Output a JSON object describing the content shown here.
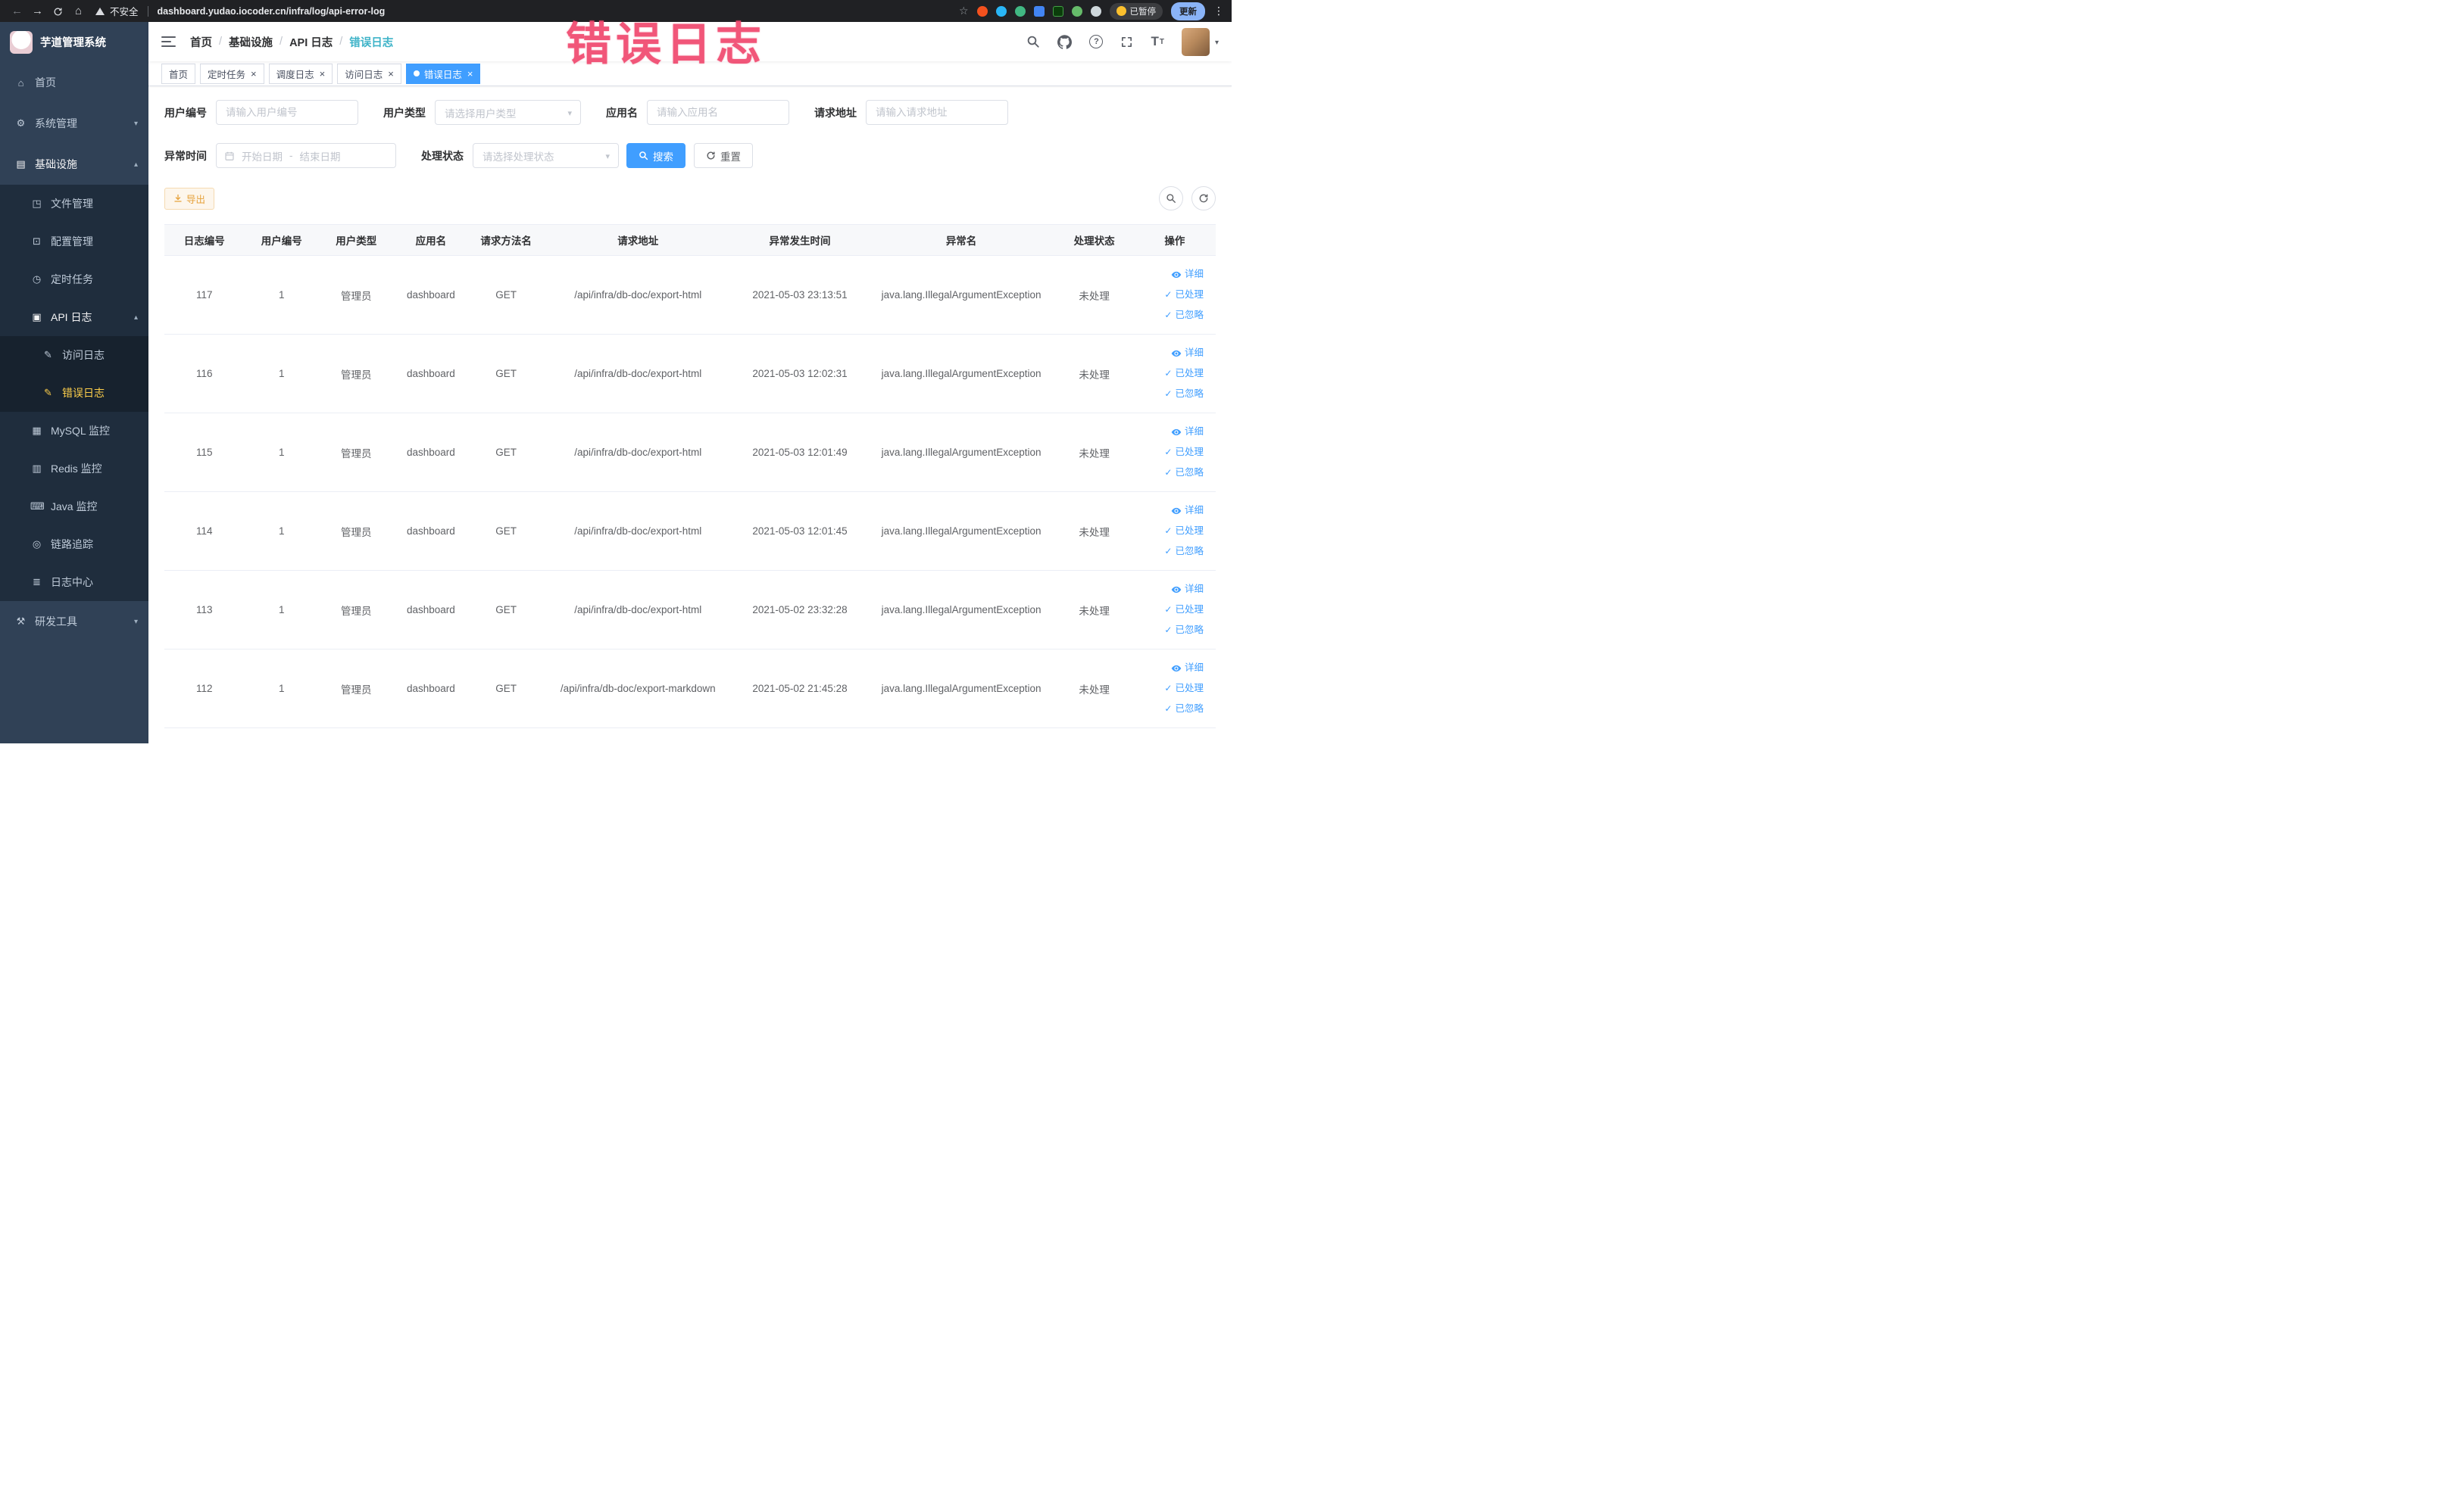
{
  "browser": {
    "insecure_label": "不安全",
    "url": "dashboard.yudao.iocoder.cn/infra/log/api-error-log",
    "paused_badge": "已暂停",
    "update_button": "更新"
  },
  "annotation": {
    "text": "错误日志"
  },
  "sidebar": {
    "logo_title": "芋道管理系统",
    "menu": [
      {
        "label": "首页",
        "icon": "home",
        "type": "top"
      },
      {
        "label": "系统管理",
        "icon": "gear",
        "type": "top",
        "chevron": "down"
      },
      {
        "label": "基础设施",
        "icon": "infra",
        "type": "top",
        "chevron": "up",
        "open": true
      },
      {
        "label": "文件管理",
        "icon": "file",
        "type": "sub1"
      },
      {
        "label": "配置管理",
        "icon": "config",
        "type": "sub1"
      },
      {
        "label": "定时任务",
        "icon": "timer",
        "type": "sub1"
      },
      {
        "label": "API 日志",
        "icon": "api",
        "type": "sub1",
        "chevron": "up",
        "open": true
      },
      {
        "label": "访问日志",
        "icon": "doc",
        "type": "sub2"
      },
      {
        "label": "错误日志",
        "icon": "doc",
        "type": "sub2",
        "active": true
      },
      {
        "label": "MySQL 监控",
        "icon": "mysql",
        "type": "sub1"
      },
      {
        "label": "Redis 监控",
        "icon": "redis",
        "type": "sub1"
      },
      {
        "label": "Java 监控",
        "icon": "java",
        "type": "sub1"
      },
      {
        "label": "链路追踪",
        "icon": "trace",
        "type": "sub1"
      },
      {
        "label": "日志中心",
        "icon": "logcenter",
        "type": "sub1"
      },
      {
        "label": "研发工具",
        "icon": "tools",
        "type": "top",
        "chevron": "down"
      }
    ]
  },
  "breadcrumb": {
    "items": [
      "首页",
      "基础设施",
      "API 日志",
      "错误日志"
    ]
  },
  "tabs": [
    {
      "label": "首页",
      "closable": false,
      "active": false
    },
    {
      "label": "定时任务",
      "closable": true,
      "active": false
    },
    {
      "label": "调度日志",
      "closable": true,
      "active": false
    },
    {
      "label": "访问日志",
      "closable": true,
      "active": false
    },
    {
      "label": "错误日志",
      "closable": true,
      "active": true
    }
  ],
  "filters": {
    "user_id": {
      "label": "用户编号",
      "placeholder": "请输入用户编号"
    },
    "user_type": {
      "label": "用户类型",
      "placeholder": "请选择用户类型"
    },
    "app_name": {
      "label": "应用名",
      "placeholder": "请输入应用名"
    },
    "request_url": {
      "label": "请求地址",
      "placeholder": "请输入请求地址"
    },
    "exception_time": {
      "label": "异常时间",
      "start_placeholder": "开始日期",
      "separator": "-",
      "end_placeholder": "结束日期"
    },
    "process_status": {
      "label": "处理状态",
      "placeholder": "请选择处理状态"
    },
    "search_button": "搜索",
    "reset_button": "重置"
  },
  "toolbar": {
    "export_button": "导出"
  },
  "table": {
    "columns": [
      "日志编号",
      "用户编号",
      "用户类型",
      "应用名",
      "请求方法名",
      "请求地址",
      "异常发生时间",
      "异常名",
      "处理状态",
      "操作"
    ],
    "action_labels": {
      "detail": "详细",
      "processed": "已处理",
      "ignored": "已忽略"
    },
    "rows": [
      {
        "id": "117",
        "user_id": "1",
        "user_type": "管理员",
        "app": "dashboard",
        "method": "GET",
        "url": "/api/infra/db-doc/export-html",
        "time": "2021-05-03 23:13:51",
        "exception": "java.lang.IllegalArgumentException",
        "status": "未处理"
      },
      {
        "id": "116",
        "user_id": "1",
        "user_type": "管理员",
        "app": "dashboard",
        "method": "GET",
        "url": "/api/infra/db-doc/export-html",
        "time": "2021-05-03 12:02:31",
        "exception": "java.lang.IllegalArgumentException",
        "status": "未处理"
      },
      {
        "id": "115",
        "user_id": "1",
        "user_type": "管理员",
        "app": "dashboard",
        "method": "GET",
        "url": "/api/infra/db-doc/export-html",
        "time": "2021-05-03 12:01:49",
        "exception": "java.lang.IllegalArgumentException",
        "status": "未处理"
      },
      {
        "id": "114",
        "user_id": "1",
        "user_type": "管理员",
        "app": "dashboard",
        "method": "GET",
        "url": "/api/infra/db-doc/export-html",
        "time": "2021-05-03 12:01:45",
        "exception": "java.lang.IllegalArgumentException",
        "status": "未处理"
      },
      {
        "id": "113",
        "user_id": "1",
        "user_type": "管理员",
        "app": "dashboard",
        "method": "GET",
        "url": "/api/infra/db-doc/export-html",
        "time": "2021-05-02 23:32:28",
        "exception": "java.lang.IllegalArgumentException",
        "status": "未处理"
      },
      {
        "id": "112",
        "user_id": "1",
        "user_type": "管理员",
        "app": "dashboard",
        "method": "GET",
        "url": "/api/infra/db-doc/export-markdown",
        "time": "2021-05-02 21:45:28",
        "exception": "java.lang.IllegalArgumentException",
        "status": "未处理"
      }
    ]
  },
  "colors": {
    "primary": "#409EFF",
    "warning": "#e6a23c",
    "sidebar_active": "#ffd04b",
    "annotation": "#f0486e"
  }
}
